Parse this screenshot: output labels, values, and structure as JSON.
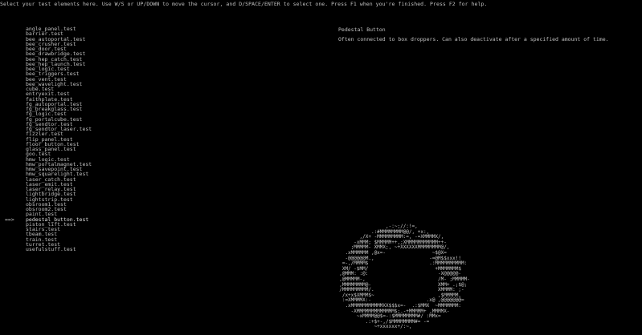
{
  "instructions": "Select your test elements here. Use W/S or UP/DOWN to move the cursor, and D/SPACE/ENTER to select one. Press F1 when you're finished. Press F2 for help.",
  "cursor": "==>",
  "selected_index": 38,
  "tests": [
    "angle_panel.test",
    "barrier.test",
    "bee_autoportal.test",
    "bee_crusher.test",
    "bee_door.test",
    "bee_drawbridge.test",
    "bee_hep_catch.test",
    "bee_hep_launch.test",
    "bee_logic.test",
    "bee_triggers.test",
    "bee_vent.test",
    "bee_wavelight.test",
    "cube.test",
    "entryexit.test",
    "faithplate.test",
    "fg_autoportal.test",
    "fg_breakglass.test",
    "fg_logic.test",
    "fg_portalcube.test",
    "fg_sendtor.test",
    "fg_sendtor_laser.test",
    "fizzler.test",
    "flip_panel.test",
    "floor_button.test",
    "glass_panel.test",
    "goo.test",
    "hmw_logic.test",
    "hmw_portalmagnet.test",
    "hmw_savepoint.test",
    "hmw_squarelight.test",
    "laser_catch.test",
    "laser_emit.test",
    "laser_relay.test",
    "lightbridge.test",
    "lightstrip.test",
    "obsroom1.test",
    "obsroom2.test",
    "paint.test",
    "pedestal_button.test",
    "piston_lift.test",
    "stairs.test",
    "tbeam.test",
    "train.test",
    "turret.test",
    "usefulstuff.test"
  ],
  "detail": {
    "title": "Pedestal Button",
    "description": "Often connected to box droppers. Can also deactivate after a specified amount of time."
  },
  "ascii_art": [
    "                  ,-:~;//:!=,",
    "             .:#MMMMMMMM@@/, +x:,",
    "         ,/X+ -MMMMMMMMM:=, -=XMMMMX/,",
    "       -xMMM; $MMMMM++,;XMMMMMMMMMMM++-",
    "      ;MMMMM- XMMX;, ~+XXXXXXMMMMMMMM@/,",
    "    .xMMMMMM ,@x=-                ~$@X=",
    "    -@@@@@@M.,                   -=@M$$xxx!!",
    "   =-,/MMMM$                     .:MMMMMMMMMM:",
    "   XM/ -$MM/                       +MMMMMMM$",
    "  ,@MMM: :@:                        -X@@@@@-",
    "  ,@MMMMM-,                         /M- ;MMMMM-",
    "  ,MMMMMMMM@-                       XMM+ .;$@;",
    "  /MMMMMMMMM/.                      XMMMM: ;-",
    "   /x+x$XMMM$~                      ,$MMMMM,",
    "   :=XMMMMX:-                   .x@ ,@@@@@@@=",
    "    .xMMMMMMMMMMMXX$$$x=-  .:$MMX  ~MMMMMMM:",
    "      -XMMMMMMMMMMMMM$;.-+MMMMM+ ,MMMMX-",
    "        ~xMMMM@@$=-:$MMMMMMMM#/ :MMx=",
    "           .:+$+-,/$MMMMMMMM#= -=",
    "              ~+xxxxxx+/:~,"
  ],
  "colors": {
    "background": "#000000",
    "text": "#c0c0c0"
  }
}
